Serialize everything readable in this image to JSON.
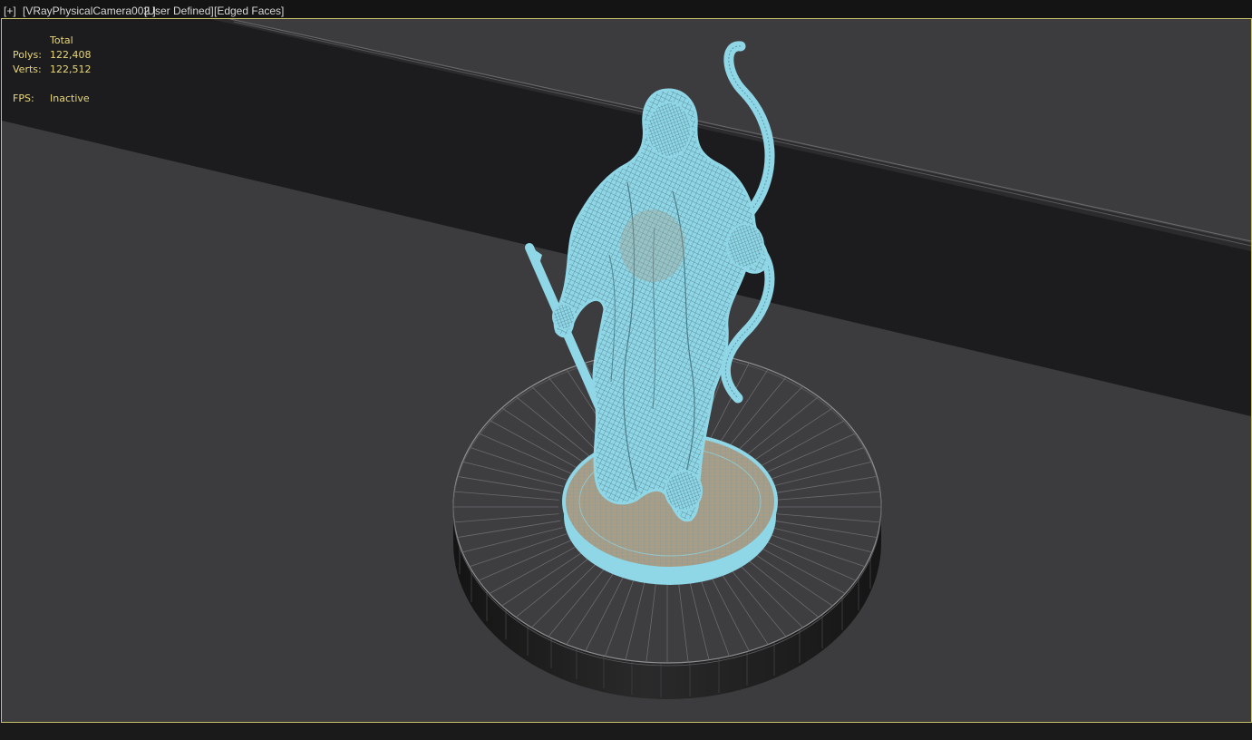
{
  "viewport_label": {
    "plus_menu": "[+]",
    "camera_menu": "[VRayPhysicalCamera002 ]",
    "view_menu": "[User Defined]",
    "shading_menu": "[Edged Faces]"
  },
  "stats": {
    "header": "Total",
    "polys_label": "Polys:",
    "polys_value": "122,408",
    "verts_label": "Verts:",
    "verts_value": "122,512",
    "fps_label": "FPS:",
    "fps_value": "Inactive"
  },
  "colors": {
    "viewport_background": "#3c3c3f",
    "active_viewport_border": "#c9c46a",
    "stats_text": "#e8d87a",
    "selected_wireframe": "#8fd6e6",
    "pedestal_top": "#3e3e41",
    "pedestal_side": "#1b1b1c",
    "back_wall": "#1c1c1e"
  },
  "icons": {
    "statue": "archer-statue-wireframe",
    "pedestal": "cylinder-pedestal-mesh"
  }
}
